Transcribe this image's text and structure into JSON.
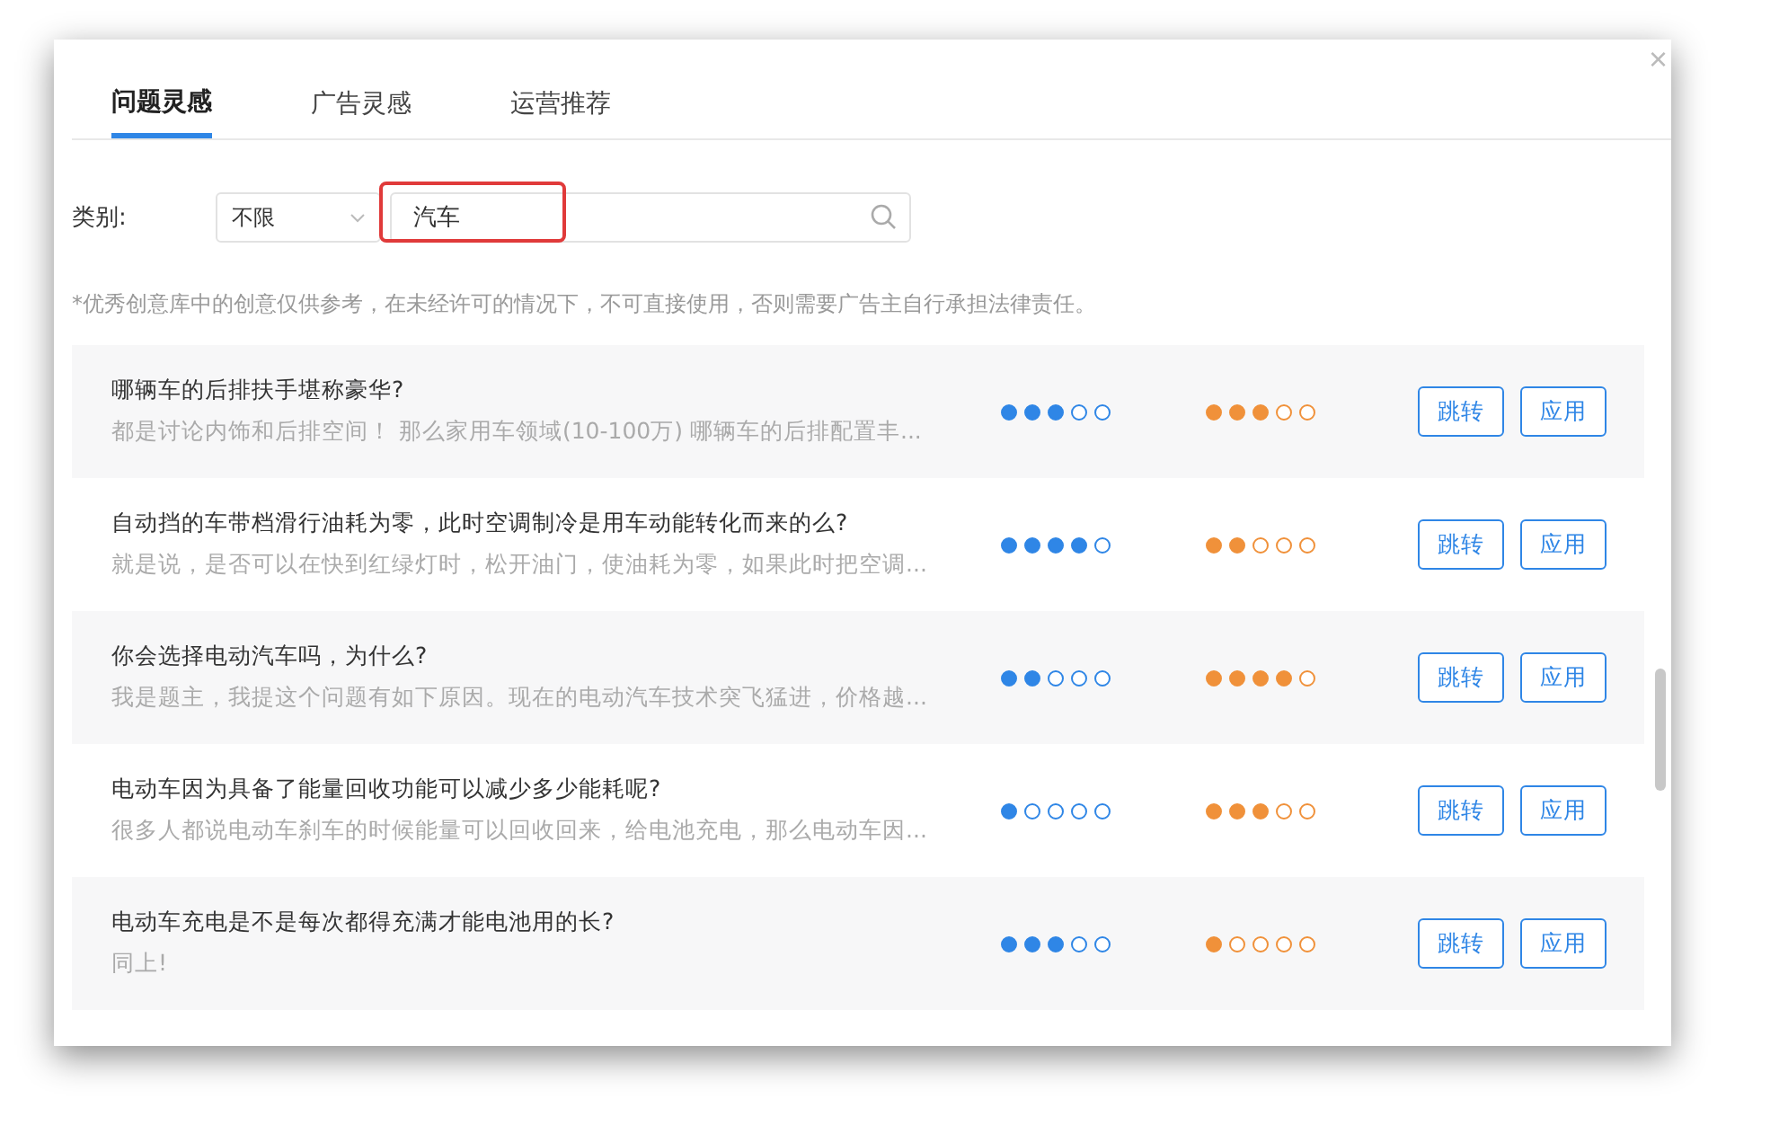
{
  "dialog": {
    "close": "×"
  },
  "tabs": [
    {
      "label": "问题灵感",
      "selected": true
    },
    {
      "label": "广告灵感",
      "selected": false
    },
    {
      "label": "运营推荐",
      "selected": false
    }
  ],
  "filter": {
    "label": "类别:",
    "category": "不限",
    "search": {
      "value": "汽车",
      "highlighted": true
    }
  },
  "notice": "*优秀创意库中的创意仅供参考，在未经许可的情况下，不可直接使用，否则需要广告主自行承担法律责任。",
  "rows": [
    {
      "title": "哪辆车的后排扶手堪称豪华?",
      "snippet": "都是讨论内饰和后排空间！  那么家用车领域(10-100万) 哪辆车的后排配置丰...",
      "metrics": [
        {
          "stars": 3,
          "color": "#2f86e6"
        },
        {
          "stars": 3,
          "color": "#f0913a"
        }
      ],
      "actions": [
        "跳转",
        "应用"
      ]
    },
    {
      "title": "自动挡的车带档滑行油耗为零，此时空调制冷是用车动能转化而来的么?",
      "snippet": "就是说，是否可以在快到红绿灯时，松开油门，使油耗为零，如果此时把空调...",
      "metrics": [
        {
          "stars": 4,
          "color": "#2f86e6"
        },
        {
          "stars": 2,
          "color": "#f0913a"
        }
      ],
      "actions": [
        "跳转",
        "应用"
      ]
    },
    {
      "title": "你会选择电动汽车吗，为什么?",
      "snippet": "我是题主，我提这个问题有如下原因。现在的电动汽车技术突飞猛进，价格越...",
      "metrics": [
        {
          "stars": 2,
          "color": "#2f86e6"
        },
        {
          "stars": 4,
          "color": "#f0913a"
        }
      ],
      "actions": [
        "跳转",
        "应用"
      ]
    },
    {
      "title": "电动车因为具备了能量回收功能可以减少多少能耗呢?",
      "snippet": "很多人都说电动车刹车的时候能量可以回收回来，给电池充电，那么电动车因...",
      "metrics": [
        {
          "stars": 1,
          "color": "#2f86e6"
        },
        {
          "stars": 3,
          "color": "#f0913a"
        }
      ],
      "actions": [
        "跳转",
        "应用"
      ]
    },
    {
      "title": "电动车充电是不是每次都得充满才能电池用的长?",
      "snippet": "同上!",
      "metrics": [
        {
          "stars": 3,
          "color": "#2f86e6"
        },
        {
          "stars": 1,
          "color": "#f0913a"
        }
      ],
      "actions": [
        "跳转",
        "应用"
      ]
    }
  ]
}
